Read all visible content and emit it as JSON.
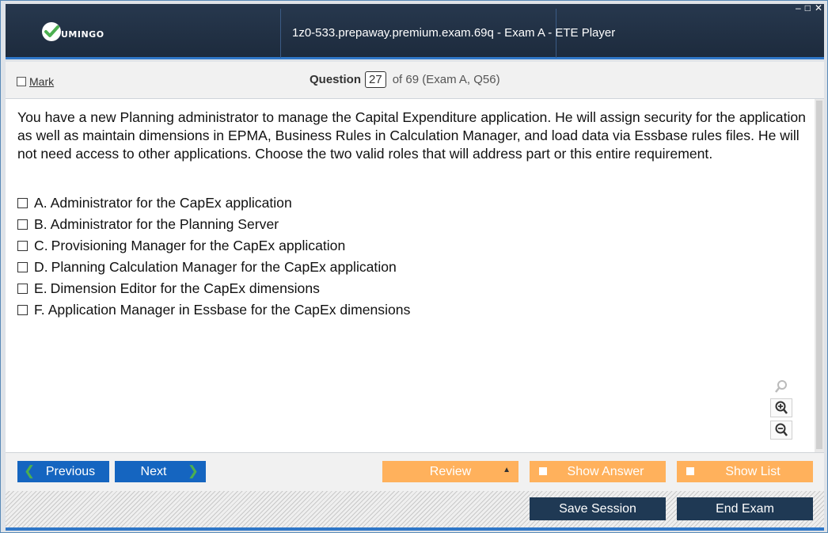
{
  "window": {
    "title": "1z0-533.prepaway.premium.exam.69q - Exam A - ETE Player",
    "logo_text": "UMINGO",
    "controls": {
      "minimize": "–",
      "maximize": "□",
      "close": "✕"
    }
  },
  "header": {
    "mark_label": "Mark",
    "question_label": "Question",
    "question_number": "27",
    "question_of": "of 69 (Exam A, Q56)"
  },
  "question": {
    "text": "You have a new Planning administrator to manage the Capital Expenditure application. He will assign security for the application as well as maintain dimensions in EPMA, Business Rules in Calculation Manager, and load data via Essbase rules files. He will not need access to other applications. Choose the two valid roles that will address part or this entire requirement.",
    "options": [
      {
        "letter": "A.",
        "text": "Administrator for the CapEx application"
      },
      {
        "letter": "B.",
        "text": "Administrator for the Planning Server"
      },
      {
        "letter": "C.",
        "text": "Provisioning Manager for the CapEx application"
      },
      {
        "letter": "D.",
        "text": "Planning Calculation Manager for the CapEx application"
      },
      {
        "letter": "E.",
        "text": "Dimension Editor for the CapEx dimensions"
      },
      {
        "letter": "F.",
        "text": "Application Manager in Essbase for the CapEx dimensions"
      }
    ]
  },
  "zoom": {
    "icons": [
      "search-icon",
      "zoom-in-icon",
      "zoom-out-icon"
    ]
  },
  "nav": {
    "previous": "Previous",
    "next": "Next",
    "review": "Review",
    "show_answer": "Show Answer",
    "show_list": "Show List",
    "save_session": "Save Session",
    "end_exam": "End Exam"
  },
  "colors": {
    "titlebar": "#1d2b3d",
    "accent_blue": "#1565c0",
    "orange": "#ffb15c",
    "dark_button": "#1f3954",
    "logo_green": "#4caf50"
  }
}
